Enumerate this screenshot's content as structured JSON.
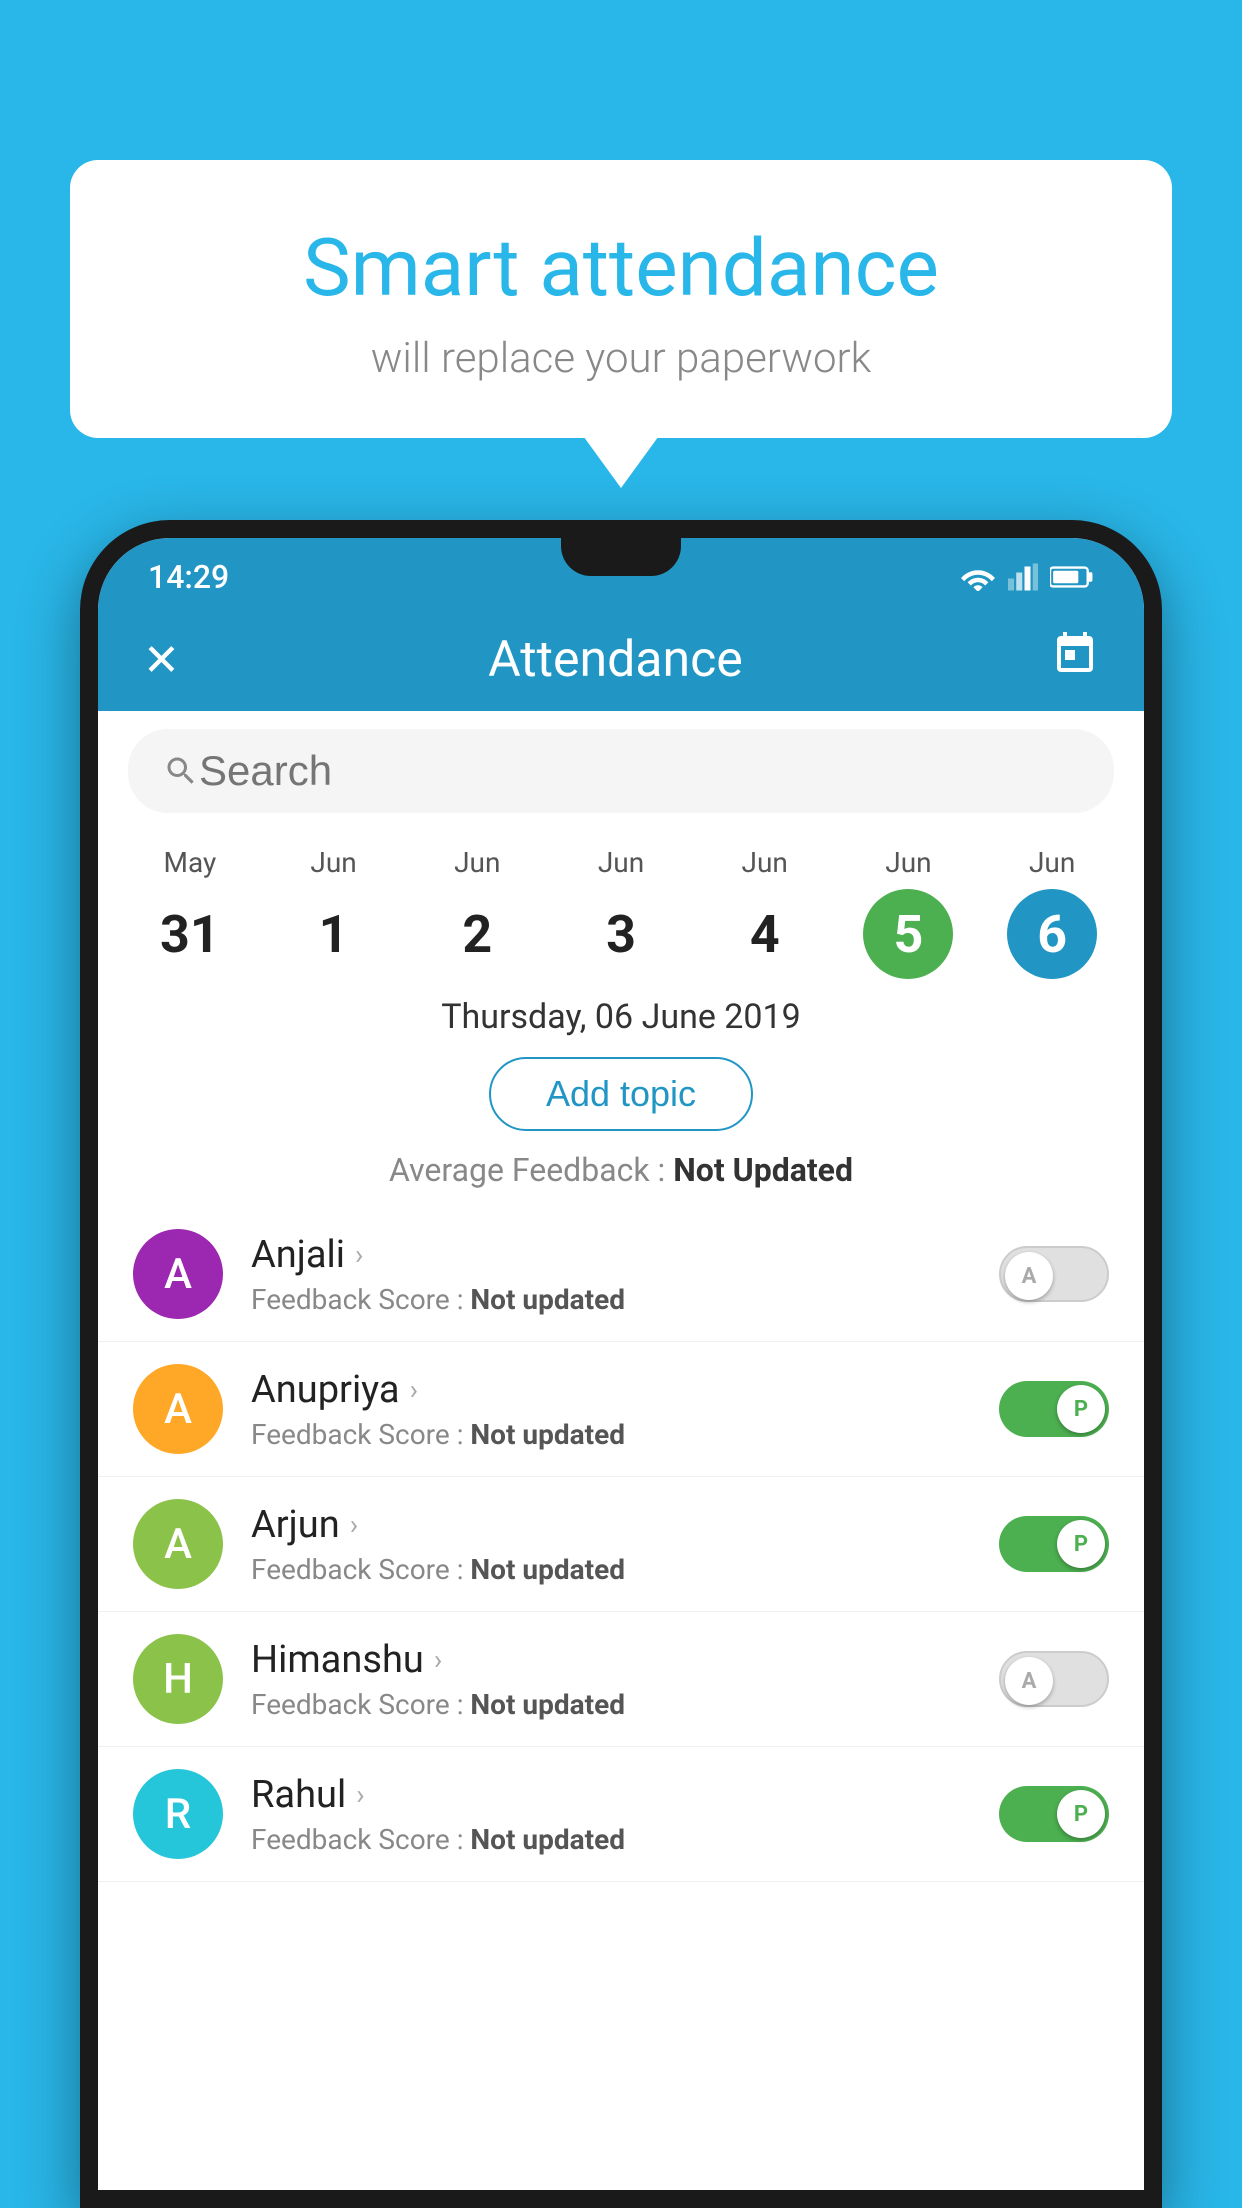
{
  "background": {
    "color": "#29b6e8"
  },
  "speech_bubble": {
    "title": "Smart attendance",
    "subtitle": "will replace your paperwork"
  },
  "status_bar": {
    "time": "14:29"
  },
  "app_bar": {
    "title": "Attendance",
    "close_label": "✕",
    "calendar_label": "📅"
  },
  "search": {
    "placeholder": "Search"
  },
  "calendar": {
    "days": [
      {
        "month": "May",
        "day": "31",
        "style": "normal"
      },
      {
        "month": "Jun",
        "day": "1",
        "style": "normal"
      },
      {
        "month": "Jun",
        "day": "2",
        "style": "normal"
      },
      {
        "month": "Jun",
        "day": "3",
        "style": "normal"
      },
      {
        "month": "Jun",
        "day": "4",
        "style": "normal"
      },
      {
        "month": "Jun",
        "day": "5",
        "style": "green"
      },
      {
        "month": "Jun",
        "day": "6",
        "style": "blue"
      }
    ]
  },
  "selected_date": "Thursday, 06 June 2019",
  "add_topic_label": "Add topic",
  "feedback_summary": {
    "label": "Average Feedback : ",
    "value": "Not Updated"
  },
  "students": [
    {
      "name": "Anjali",
      "avatar_letter": "A",
      "avatar_color": "#9c27b0",
      "feedback_label": "Feedback Score : ",
      "feedback_value": "Not updated",
      "toggle_state": "off",
      "toggle_label": "A"
    },
    {
      "name": "Anupriya",
      "avatar_letter": "A",
      "avatar_color": "#ffa726",
      "feedback_label": "Feedback Score : ",
      "feedback_value": "Not updated",
      "toggle_state": "on",
      "toggle_label": "P"
    },
    {
      "name": "Arjun",
      "avatar_letter": "A",
      "avatar_color": "#8bc34a",
      "feedback_label": "Feedback Score : ",
      "feedback_value": "Not updated",
      "toggle_state": "on",
      "toggle_label": "P"
    },
    {
      "name": "Himanshu",
      "avatar_letter": "H",
      "avatar_color": "#8bc34a",
      "feedback_label": "Feedback Score : ",
      "feedback_value": "Not updated",
      "toggle_state": "off",
      "toggle_label": "A"
    },
    {
      "name": "Rahul",
      "avatar_letter": "R",
      "avatar_color": "#26c6da",
      "feedback_label": "Feedback Score : ",
      "feedback_value": "Not updated",
      "toggle_state": "on",
      "toggle_label": "P"
    }
  ]
}
